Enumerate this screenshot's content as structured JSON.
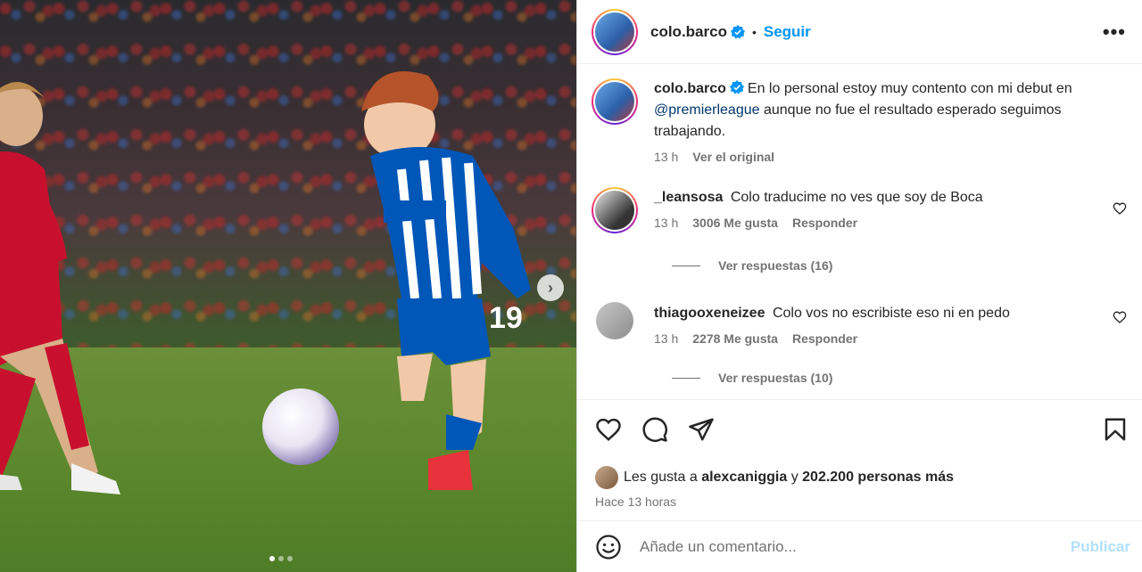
{
  "post": {
    "username": "colo.barco",
    "follow_label": "Seguir",
    "separator": "•",
    "more_label": "•••",
    "caption_text": "En lo personal estoy muy contento con mi debut en",
    "caption_mention": "@premierleague",
    "caption_rest": "aunque no fue el resultado esperado seguimos trabajando.",
    "caption_time": "13 h",
    "see_original": "Ver el original",
    "jersey_number": "19"
  },
  "comments": [
    {
      "username": "_leansosa",
      "text": "Colo traducime no ves que soy de Boca",
      "time": "13 h",
      "likes": "3006 Me gusta",
      "reply_label": "Responder",
      "view_replies": "Ver respuestas (16)"
    },
    {
      "username": "thiagooxeneizee",
      "text": "Colo vos no escribiste eso ni en pedo",
      "time": "13 h",
      "likes": "2278 Me gusta",
      "reply_label": "Responder",
      "view_replies": "Ver respuestas (10)"
    }
  ],
  "likes_line": {
    "prefix": "Les gusta a",
    "user": "alexcaniggia",
    "middle": "y",
    "count": "202.200 personas más"
  },
  "posted_ago": "Hace 13 horas",
  "composer": {
    "placeholder": "Añade un comentario...",
    "publish_label": "Publicar"
  },
  "icons": {
    "verified": "verified-badge-icon",
    "like": "heart-icon",
    "comment": "comment-icon",
    "share": "share-icon",
    "save": "bookmark-icon",
    "emoji": "emoji-icon",
    "next": "chevron-right-icon"
  },
  "colors": {
    "accent": "#0095f6",
    "verified": "#0095f6",
    "publish_disabled": "#b2dffc"
  },
  "carousel": {
    "count": 3,
    "active_index": 0
  }
}
